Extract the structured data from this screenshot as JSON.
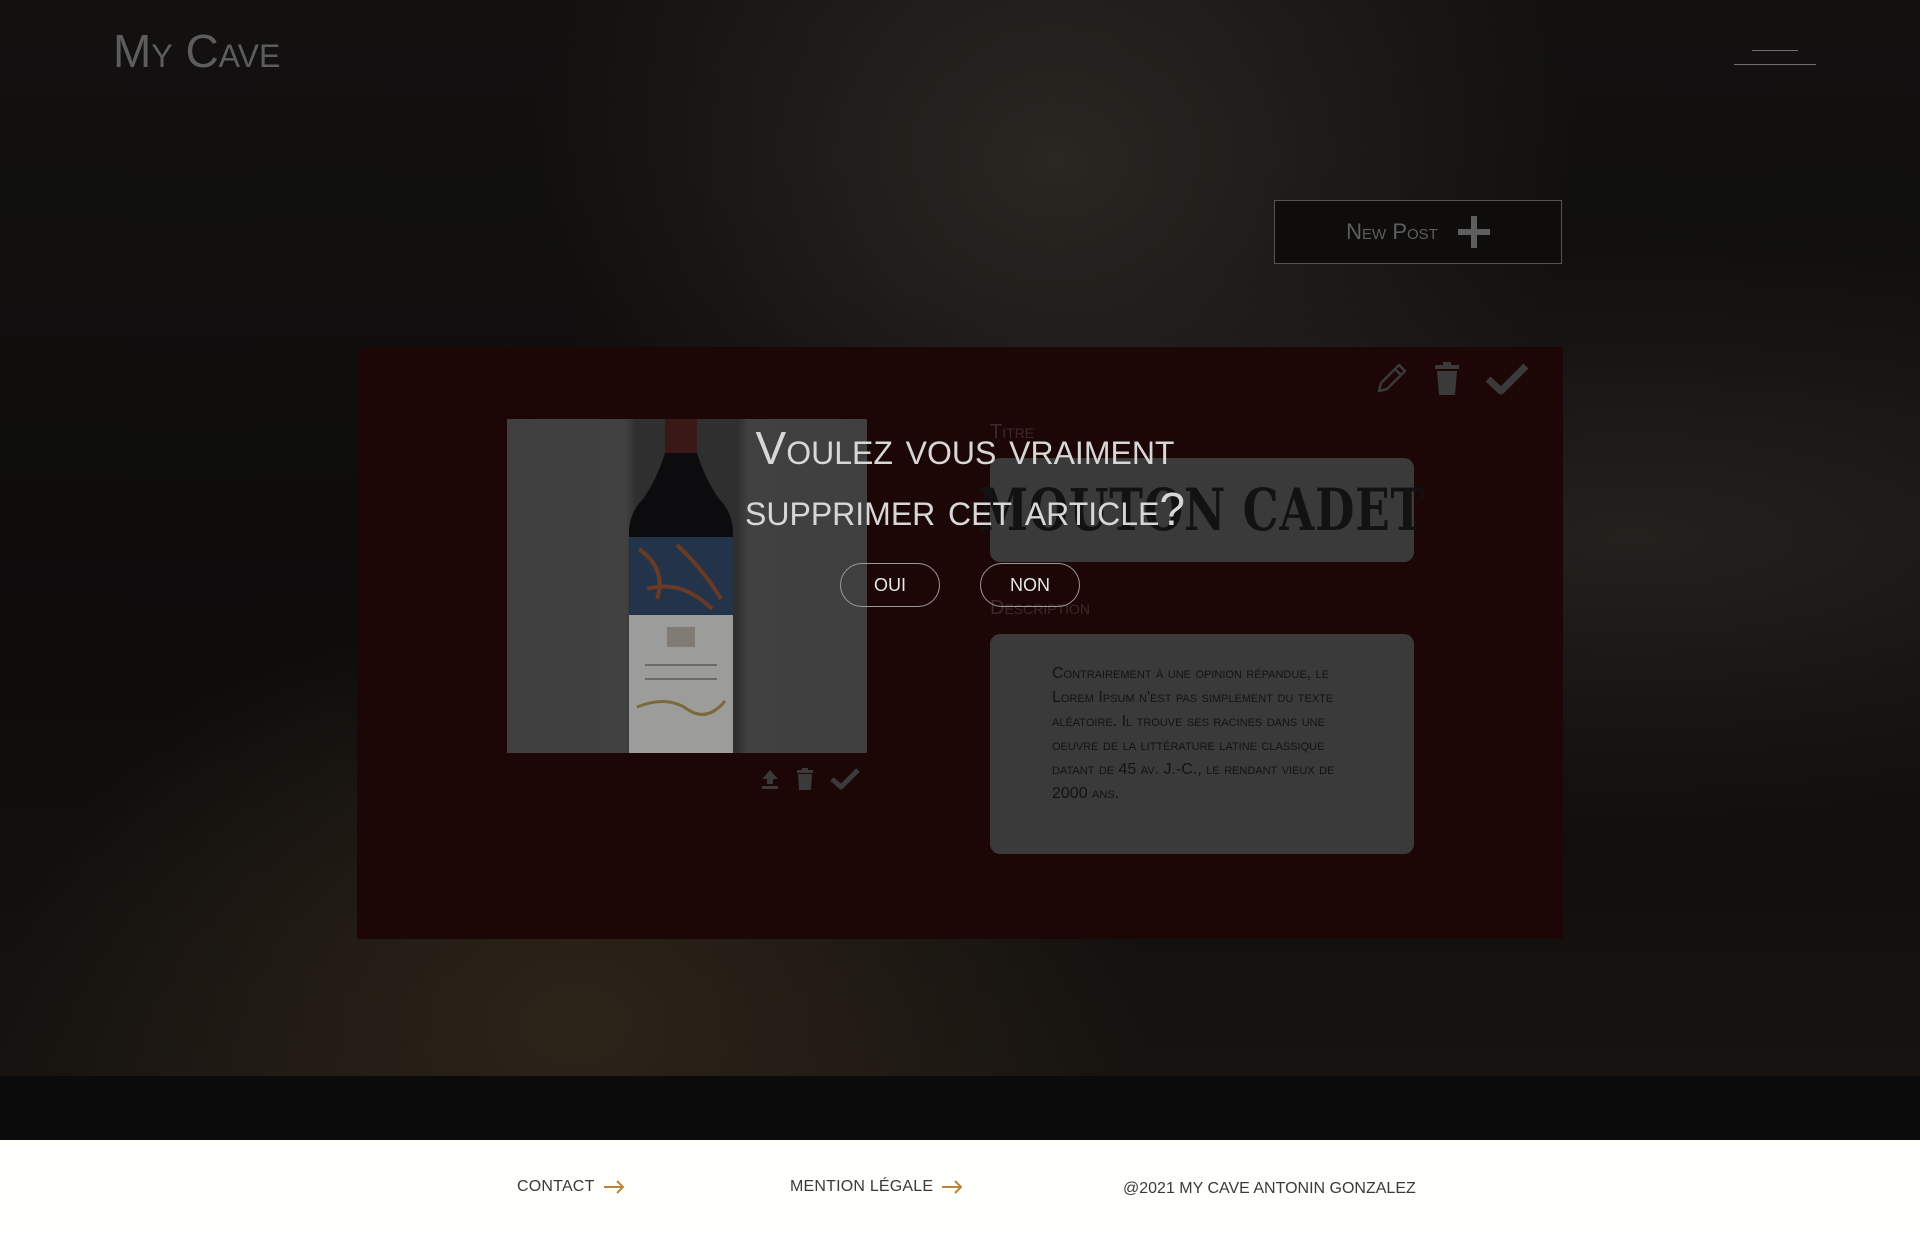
{
  "app": {
    "logo": "My Cave"
  },
  "header": {
    "menu_icon": "hamburger-icon"
  },
  "toolbar": {
    "new_post_label": "New Post",
    "new_post_icon": "plus-icon"
  },
  "post": {
    "actions": [
      "pencil-icon",
      "trash-icon",
      "check-icon"
    ],
    "photo_actions": [
      "upload-icon",
      "trash-icon",
      "check-icon"
    ],
    "title_label": "Titre",
    "title_value": "MOUTON CADET",
    "description_label": "Description",
    "description_value": "Contrairement à une opinion répandue, le Lorem Ipsum n'est pas simplement du texte aléatoire. Il trouve ses racines dans une oeuvre de la littérature latine classique datant de 45 av. J.-C., le rendant vieux de 2000 ans."
  },
  "dialog": {
    "question_line1": "Voulez vous vraiment",
    "question_line2": "supprimer cet article?",
    "yes_label": "OUI",
    "no_label": "NON"
  },
  "footer": {
    "contact_label": "CONTACT",
    "legal_label": "MENTION LÉGALE",
    "copyright": "@2021 MY CAVE ANTONIN GONZALEZ"
  },
  "colors": {
    "card_background": "#1c0606",
    "footer_arrow": "#b8863b",
    "footer_background": "#fffffb"
  }
}
